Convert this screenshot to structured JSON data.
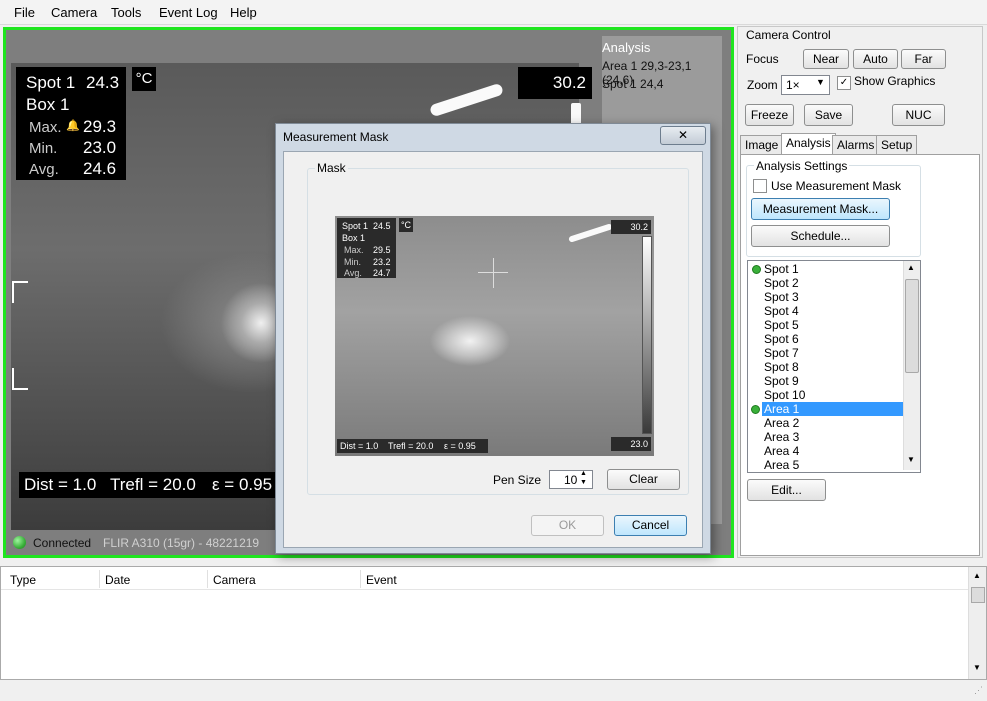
{
  "menu": {
    "file": "File",
    "camera": "Camera",
    "tools": "Tools",
    "event_log": "Event Log",
    "help": "Help"
  },
  "viewer": {
    "spot_label": "Spot 1",
    "spot_value": "24.3",
    "unit": "°C",
    "box_label": "Box 1",
    "max_label": "Max.",
    "max_value": "29.3",
    "min_label": "Min.",
    "min_value": "23.0",
    "avg_label": "Avg.",
    "avg_value": "24.6",
    "scale_max": "30.2",
    "dist": "Dist = 1.0",
    "trefl": "Trefl = 20.0",
    "emissivity": "ε = 0.95",
    "status": "Connected",
    "camera_name": "FLIR A310 (15gr) - 48221219",
    "analysis_title": "Analysis",
    "analysis_lines": [
      "Area 1 29,3-23,1 (24,6)",
      "Spot 1 24,4"
    ]
  },
  "camera_control": {
    "title": "Camera Control",
    "focus_label": "Focus",
    "near": "Near",
    "auto": "Auto",
    "far": "Far",
    "zoom_label": "Zoom",
    "zoom_value": "1×",
    "show_graphics": "Show Graphics",
    "freeze": "Freeze",
    "save": "Save",
    "nuc": "NUC"
  },
  "tabs": [
    "Image",
    "Analysis",
    "Alarms",
    "Setup"
  ],
  "analysis_settings": {
    "title": "Analysis Settings",
    "use_mask": "Use Measurement Mask",
    "mask_button": "Measurement Mask...",
    "schedule_button": "Schedule..."
  },
  "items": [
    "Spot 1",
    "Spot 2",
    "Spot 3",
    "Spot 4",
    "Spot 5",
    "Spot 6",
    "Spot 7",
    "Spot 8",
    "Spot 9",
    "Spot 10",
    "Area 1",
    "Area 2",
    "Area 3",
    "Area 4",
    "Area 5"
  ],
  "edit_button": "Edit...",
  "event_log": {
    "columns": [
      "Type",
      "Date",
      "Camera",
      "Event"
    ]
  },
  "dialog": {
    "title": "Measurement Mask",
    "group": "Mask",
    "preview": {
      "spot": "Spot 1",
      "spot_value": "24.5",
      "unit": "°C",
      "box": "Box 1",
      "max_label": "Max.",
      "max_value": "29.5",
      "min_label": "Min.",
      "min_value": "23.2",
      "avg_label": "Avg.",
      "avg_value": "24.7",
      "scale_max": "30.2",
      "scale_min": "23.0",
      "dist": "Dist = 1.0",
      "trefl": "Trefl = 20.0",
      "emissivity": "ε = 0.95"
    },
    "pen_size_label": "Pen Size",
    "pen_size_value": "10",
    "clear": "Clear",
    "ok": "OK",
    "cancel": "Cancel"
  },
  "colors": {
    "connected": "#3ab03a",
    "viewer_border": "#1fe51f",
    "selection": "#3399ff"
  }
}
